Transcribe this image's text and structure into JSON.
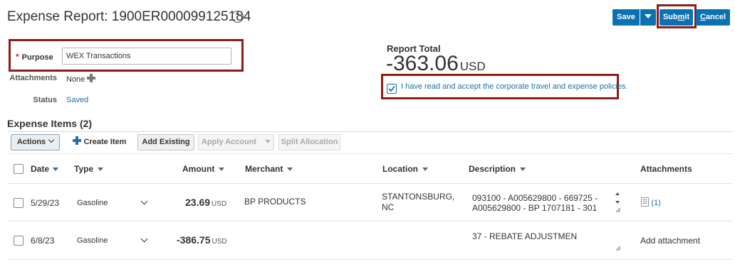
{
  "header": {
    "title": "Expense Report: 1900ER000099125184",
    "help_glyph": "?",
    "save_label": "Save",
    "submit_label_pre": "Sub",
    "submit_label_ul": "m",
    "submit_label_post": "it",
    "cancel_label_ul": "C",
    "cancel_label_post": "ancel",
    "accent_color": "#0a72b1",
    "highlight_color": "#8c1d18"
  },
  "form": {
    "purpose_required_marker": "*",
    "purpose_label": "Purpose",
    "purpose_value": "WEX Transactions",
    "attachments_label": "Attachments",
    "attachments_value": "None",
    "status_label": "Status",
    "status_value": "Saved"
  },
  "report_total": {
    "label": "Report Total",
    "amount": "-363.06",
    "currency": "USD",
    "policy_checked": true,
    "policy_text": "I have read and accept the corporate travel and expense policies."
  },
  "expense_items": {
    "heading": "Expense Items (2)",
    "toolbar": {
      "actions": "Actions",
      "create_item": "Create Item",
      "add_existing": "Add Existing",
      "apply_account": "Apply Account",
      "split_allocation": "Split Allocation"
    },
    "columns": {
      "date": "Date",
      "type": "Type",
      "amount": "Amount",
      "merchant": "Merchant",
      "location": "Location",
      "description": "Description",
      "attachments": "Attachments"
    },
    "rows": [
      {
        "date": "5/29/23",
        "type": "Gasoline",
        "amount": "23.69",
        "currency": "USD",
        "merchant": "BP PRODUCTS",
        "location_line1": "STANTONSBURG,",
        "location_line2": "NC",
        "description_line1": "093100 - A005629800 - 669725 -",
        "description_line2": "A005629800 - BP 1707181 - 301",
        "attachments": "(1)"
      },
      {
        "date": "6/8/23",
        "type": "Gasoline",
        "amount": "-386.75",
        "currency": "USD",
        "merchant": "",
        "location_line1": "",
        "location_line2": "",
        "description_line1": "37 - REBATE ADJUSTMEN",
        "description_line2": "",
        "attachments": "Add attachment"
      }
    ]
  }
}
